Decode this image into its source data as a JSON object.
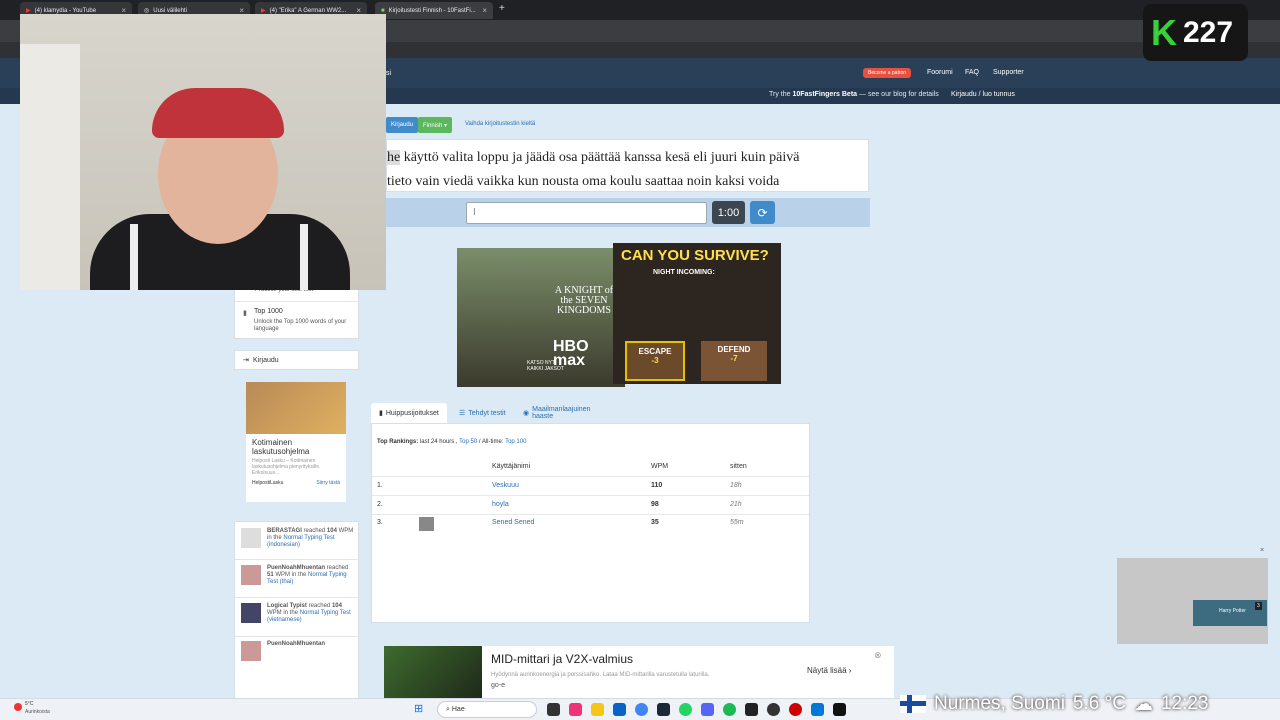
{
  "browser": {
    "tabs": [
      {
        "label": "(4) klamydia - YouTube"
      },
      {
        "label": "Uusi välilehti"
      },
      {
        "label": "(4) \"Erika\" A German WW2..."
      },
      {
        "label": "Kirjoitustesti Finnish - 10FastFi..."
      }
    ],
    "new_tab": "+"
  },
  "counter": {
    "letter": "K",
    "value": "227"
  },
  "header": {
    "patreon": "Become a patron",
    "nav": [
      "Foorumi",
      "FAQ",
      "Supporter"
    ],
    "beta_prefix": "Try the ",
    "beta_bold": "10FastFingers Beta",
    "beta_suffix": " — see our blog for details",
    "login": "Kirjaudu / luo tunnus"
  },
  "langbar": {
    "login": "Kirjaudu",
    "language": "Finnish ▾",
    "change": "Vaihda kirjoitustestin kieltä"
  },
  "typing": {
    "highlighted": "he",
    "line1_rest": " käyttö valita loppu ja jäädä osa päättää kanssa kesä eli juuri kuin päivä",
    "line2": "tieto vain viedä vaikka kun nousta oma koulu saattaa noin kaksi voida",
    "input_value": "I",
    "timer": "1:00",
    "reload_icon": "⟳"
  },
  "ads": {
    "hbo_title": "A KNIGHT of the SEVEN KINGDOMS",
    "hbo_logo": "HBO max",
    "hbo_cta": "KATSO NYT KAIKKI JAKSOT",
    "game_headline": "CAN YOU SURVIVE?",
    "game_sub": "NIGHT INCOMING:",
    "game_escape": "ESCAPE",
    "game_escape_cost": "-3",
    "game_defend": "DEFEND",
    "game_defend_cost": "-7"
  },
  "sidebar": {
    "practice_fragment": "Practice your skill test",
    "top1000_title": "Top 1000",
    "top1000_desc": "Unlock the Top 1000 words of your language",
    "login_label": "Kirjaudu",
    "ad_title": "Kotimainen laskutusohjelma",
    "ad_desc": "Helposti Lasku – Kotimainen laskutusohjelma pienyrityksille. Erikoisuus...",
    "ad_brand": "HelpostiLasku",
    "ad_cta": "Siirry tästä",
    "feed": [
      {
        "user": "BERASTAGI",
        "text1": " reached ",
        "wpm": "104",
        "text2": " WPM in the ",
        "test": "Normal Typing Test (indonesian)"
      },
      {
        "user": "PuenNoahMhuentan",
        "text1": " reached ",
        "wpm": "51",
        "text2": " WPM in the ",
        "test": "Normal Typing Test (thai)"
      },
      {
        "user": "Logical Typist",
        "text1": " reached ",
        "wpm": "104",
        "text2": " WPM in the ",
        "test": "Normal Typing Test (vietnamese)"
      },
      {
        "user": "PuenNoahMhuentan",
        "text1": "",
        "wpm": "",
        "text2": "",
        "test": ""
      }
    ]
  },
  "rankings": {
    "tabs": [
      "Huippusijoitukset",
      "Tehdyt testit",
      "Maailmanlaajuinen haaste"
    ],
    "filter_label": "Top Rankings:",
    "filter_24h": " last 24 hours , ",
    "filter_top50": "Top 50",
    "filter_alltime": " / All-time: ",
    "filter_top100": "Top 100",
    "columns": [
      "Käyttäjänimi",
      "WPM",
      "sitten"
    ],
    "rows": [
      {
        "rank": "1.",
        "name": "Veskuuu",
        "wpm": "110",
        "ago": "18h"
      },
      {
        "rank": "2.",
        "name": "hoyla",
        "wpm": "98",
        "ago": "21h"
      },
      {
        "rank": "3.",
        "name": "Sened Sened",
        "wpm": "35",
        "ago": "55m"
      }
    ]
  },
  "bottom_ad": {
    "title": "MID-mittari ja V2X-valmius",
    "desc": "Hyödynnä aurinkoenergia ja porssisahko. Lataa MID-mittarilla varustetulla laturilla.",
    "brand": "go-e",
    "cta": "Näytä lisää ›"
  },
  "overlay_weather": {
    "location": "Nurmes, Suomi",
    "temp": "5.6 °C",
    "time": "12:23"
  },
  "taskbar": {
    "weather_temp": "5°C",
    "weather_desc": "Aurinkoista",
    "search": "Hae",
    "thumb_badge": "3",
    "thumb_title": "Harry Potter"
  }
}
